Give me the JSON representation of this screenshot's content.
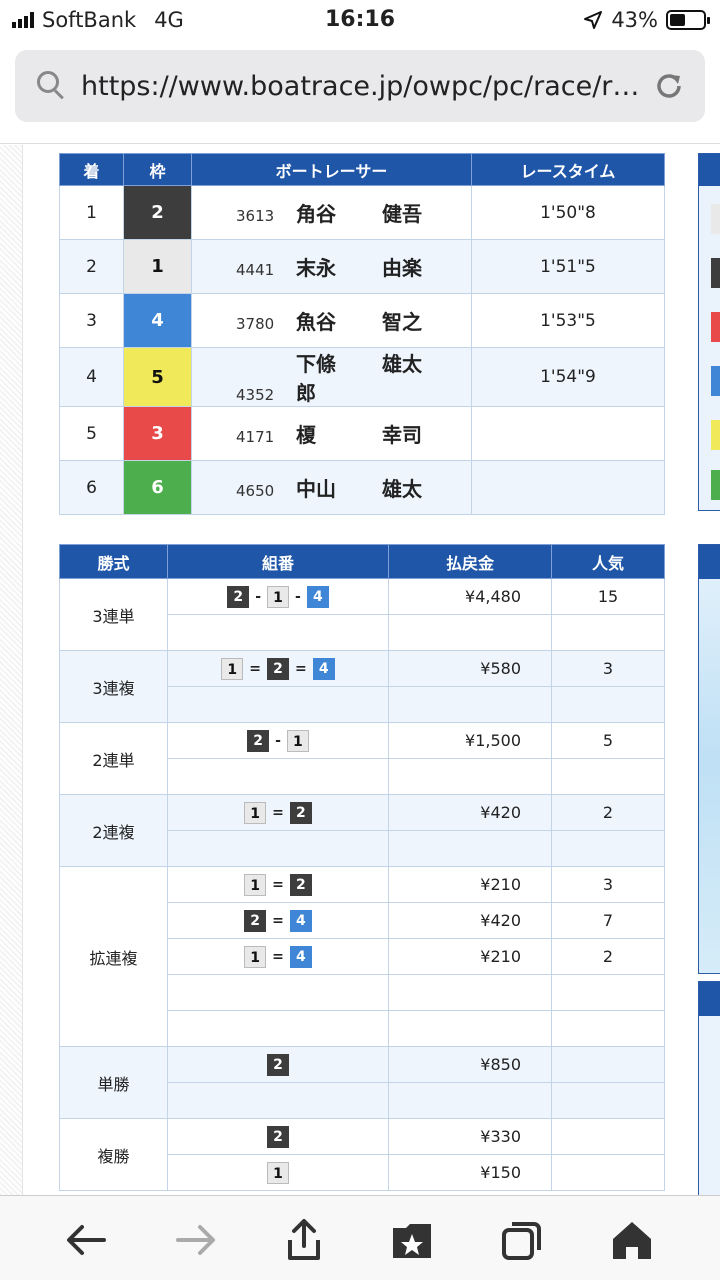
{
  "status_bar": {
    "carrier": "SoftBank",
    "network": "4G",
    "time": "16:16",
    "battery": "43%"
  },
  "browser": {
    "url": "https://www.boatrace.jp/owpc/pc/race/r…"
  },
  "result_table": {
    "headers": [
      "着",
      "枠",
      "ボートレーサー",
      "レースタイム"
    ],
    "rows": [
      {
        "place": "1",
        "waku": "2",
        "num": "3613",
        "family": "角谷",
        "given": "健吾",
        "time": "1'50\"8"
      },
      {
        "place": "2",
        "waku": "1",
        "num": "4441",
        "family": "末永",
        "given": "由楽",
        "time": "1'51\"5"
      },
      {
        "place": "3",
        "waku": "4",
        "num": "3780",
        "family": "魚谷",
        "given": "智之",
        "time": "1'53\"5"
      },
      {
        "place": "4",
        "waku": "5",
        "num": "4352",
        "family": "下條",
        "given": "雄太郎",
        "time": "1'54\"9"
      },
      {
        "place": "5",
        "waku": "3",
        "num": "4171",
        "family": "榎",
        "given": "幸司",
        "time": ""
      },
      {
        "place": "6",
        "waku": "6",
        "num": "4650",
        "family": "中山",
        "given": "雄太",
        "time": ""
      }
    ]
  },
  "waku_colors": {
    "1": {
      "bg": "#e9e9e9",
      "fg": "#111111"
    },
    "2": {
      "bg": "#3d3d3d",
      "fg": "#ffffff"
    },
    "3": {
      "bg": "#e84a4a",
      "fg": "#ffffff"
    },
    "4": {
      "bg": "#3f86d6",
      "fg": "#ffffff"
    },
    "5": {
      "bg": "#f0ea5a",
      "fg": "#111111"
    },
    "6": {
      "bg": "#4cae4c",
      "fg": "#ffffff"
    }
  },
  "payout_table": {
    "headers": [
      "勝式",
      "組番",
      "払戻金",
      "人気"
    ],
    "groups": [
      {
        "kind": "3連単",
        "rows": [
          {
            "combo": [
              "2",
              "-",
              "1",
              "-",
              "4"
            ],
            "amount": "¥4,480",
            "pop": "15"
          },
          {
            "combo": [],
            "amount": "",
            "pop": ""
          }
        ]
      },
      {
        "kind": "3連複",
        "rows": [
          {
            "combo": [
              "1",
              "=",
              "2",
              "=",
              "4"
            ],
            "amount": "¥580",
            "pop": "3"
          },
          {
            "combo": [],
            "amount": "",
            "pop": ""
          }
        ]
      },
      {
        "kind": "2連単",
        "rows": [
          {
            "combo": [
              "2",
              "-",
              "1"
            ],
            "amount": "¥1,500",
            "pop": "5"
          },
          {
            "combo": [],
            "amount": "",
            "pop": ""
          }
        ]
      },
      {
        "kind": "2連複",
        "rows": [
          {
            "combo": [
              "1",
              "=",
              "2"
            ],
            "amount": "¥420",
            "pop": "2"
          },
          {
            "combo": [],
            "amount": "",
            "pop": ""
          }
        ]
      },
      {
        "kind": "拡連複",
        "rows": [
          {
            "combo": [
              "1",
              "=",
              "2"
            ],
            "amount": "¥210",
            "pop": "3"
          },
          {
            "combo": [
              "2",
              "=",
              "4"
            ],
            "amount": "¥420",
            "pop": "7"
          },
          {
            "combo": [
              "1",
              "=",
              "4"
            ],
            "amount": "¥210",
            "pop": "2"
          },
          {
            "combo": [],
            "amount": "",
            "pop": ""
          },
          {
            "combo": [],
            "amount": "",
            "pop": ""
          }
        ]
      },
      {
        "kind": "単勝",
        "rows": [
          {
            "combo": [
              "2"
            ],
            "amount": "¥850",
            "pop": ""
          },
          {
            "combo": [],
            "amount": "",
            "pop": ""
          }
        ]
      },
      {
        "kind": "複勝",
        "rows": [
          {
            "combo": [
              "2"
            ],
            "amount": "¥330",
            "pop": ""
          },
          {
            "combo": [
              "1"
            ],
            "amount": "¥150",
            "pop": ""
          }
        ]
      }
    ]
  },
  "toolbar": {
    "items": [
      "back-icon",
      "forward-icon",
      "share-icon",
      "bookmarks-icon",
      "tabs-icon",
      "home-icon"
    ]
  }
}
